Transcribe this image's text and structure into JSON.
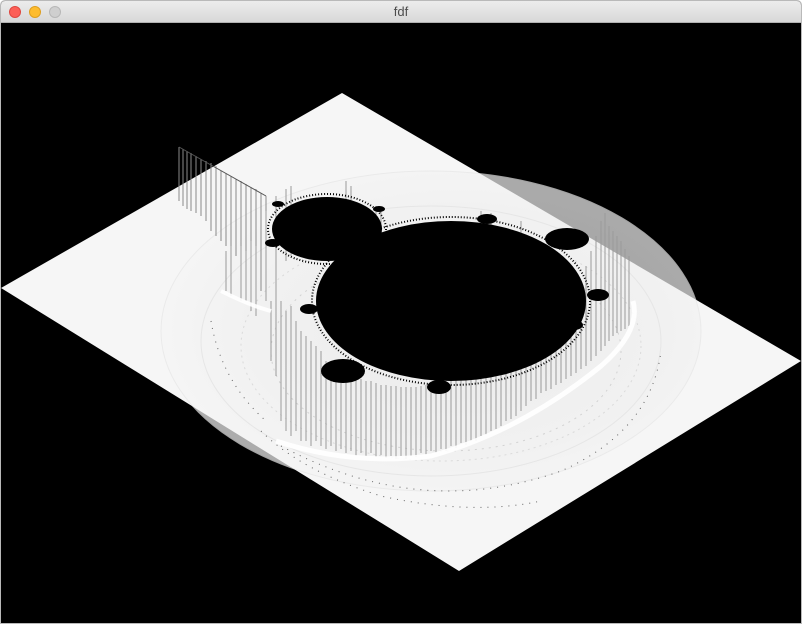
{
  "window": {
    "title": "fdf"
  },
  "controls": {
    "close": "close-button",
    "minimize": "minimize-button",
    "zoom": "zoom-button"
  },
  "render": {
    "background_color": "#000000",
    "plane_color": "#f6f6f6",
    "set_color": "#000000",
    "spike_color": "#d9d9d9"
  }
}
